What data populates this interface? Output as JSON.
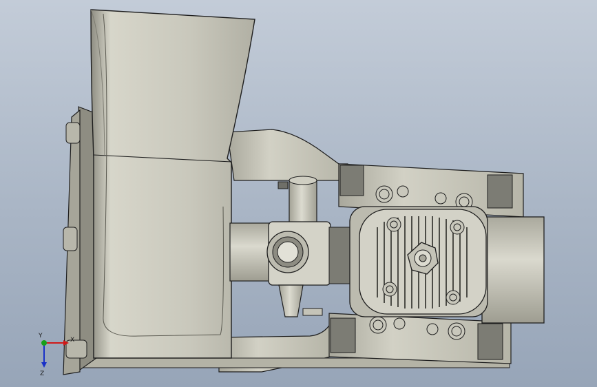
{
  "viewport": {
    "background_top": "#c3ccd8",
    "background_bottom": "#97a5b8"
  },
  "model": {
    "metal_color": "#c6c5b8",
    "shadow_color": "#9d9c90",
    "pad_color": "#7c7c74",
    "edge_color": "#1e1e1e"
  },
  "triad": {
    "x_label": "X",
    "y_label": "Y",
    "z_label": "Z",
    "x_color": "#d01818",
    "y_color": "#18a018",
    "z_color": "#1830c8"
  }
}
